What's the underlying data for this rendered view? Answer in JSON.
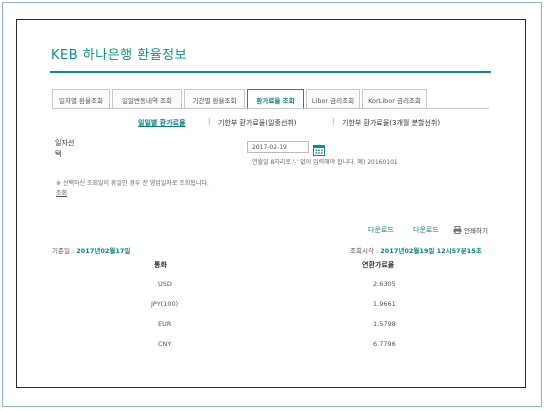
{
  "header": {
    "title": "KEB 하나은행 환율정보"
  },
  "tabs": [
    {
      "label": "일자별 환율조회",
      "active": false
    },
    {
      "label": "일일변동내역 조회",
      "active": false
    },
    {
      "label": "기간별 환율조회",
      "active": false
    },
    {
      "label": "환가료율 조회",
      "active": true
    },
    {
      "label": "Libor 금리조회",
      "active": false
    },
    {
      "label": "KorLibor 금리조회",
      "active": false
    }
  ],
  "subnav": [
    {
      "label": "일일별 환가료율",
      "active": true
    },
    {
      "label": "기한부 환가료율(일중선취)",
      "active": false
    },
    {
      "label": "기한부 환가료율(3개월 분할선취)",
      "active": false
    }
  ],
  "date_query": {
    "label": "일자선택",
    "value": "2017-02-19",
    "hint": "연월일 8자리로 '-' 없이 입력해야 합니다. 예) 20160101"
  },
  "notice": {
    "text": "※ 선택하신 조회일이 휴일인 경우 전 영업일자로 조회됩니다.",
    "link": "조회"
  },
  "actions": {
    "download1": "다운로드",
    "download2": "다운로드",
    "print": "인쇄하기"
  },
  "info": {
    "base_label": "기준일 : ",
    "base_value": "2017년02월17일",
    "query_label": "조회시각 : ",
    "query_value": "2017년02월19일 12시57분15초"
  },
  "table": {
    "headers": [
      "통화",
      "연환가료율"
    ],
    "rows": [
      {
        "currency": "USD",
        "rate": "2.6305"
      },
      {
        "currency": "JPY(100)",
        "rate": "1.9661"
      },
      {
        "currency": "EUR",
        "rate": "1.5798"
      },
      {
        "currency": "CNY",
        "rate": "6.7796"
      }
    ]
  },
  "colors": {
    "accent": "#0c8f8c",
    "frame": "#8fb9c8"
  }
}
